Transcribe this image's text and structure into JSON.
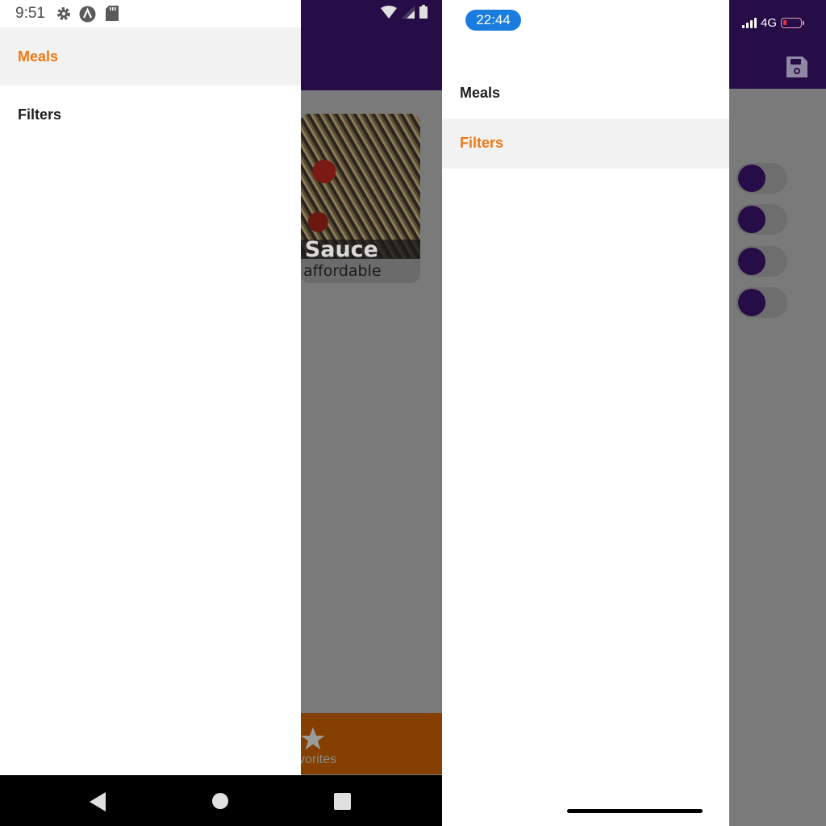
{
  "android": {
    "status": {
      "time": "9:51"
    },
    "background": {
      "meal_title_partial": "o Sauce",
      "meal_meta_partial": "affordable",
      "tab_label_partial": "vorites"
    },
    "drawer": {
      "items": [
        {
          "label": "Meals",
          "active": true
        },
        {
          "label": "Filters",
          "active": false
        }
      ]
    }
  },
  "ios": {
    "status": {
      "time": "22:44",
      "network": "4G"
    },
    "drawer": {
      "items": [
        {
          "label": "Meals",
          "active": false
        },
        {
          "label": "Filters",
          "active": true
        }
      ]
    },
    "filters": [
      {
        "on": false
      },
      {
        "on": false
      },
      {
        "on": false
      },
      {
        "on": false
      }
    ]
  },
  "colors": {
    "header": "#260d47",
    "active_label": "#f07813",
    "tab_bar": "#853f00",
    "overlay": "#7a7a7a"
  },
  "icons": [
    "settings-icon",
    "app-a-icon",
    "sd-card-icon",
    "wifi-icon",
    "signal-icon",
    "battery-icon",
    "star-icon",
    "back-icon",
    "home-icon",
    "recents-icon",
    "save-icon",
    "cellular-signal-icon"
  ]
}
